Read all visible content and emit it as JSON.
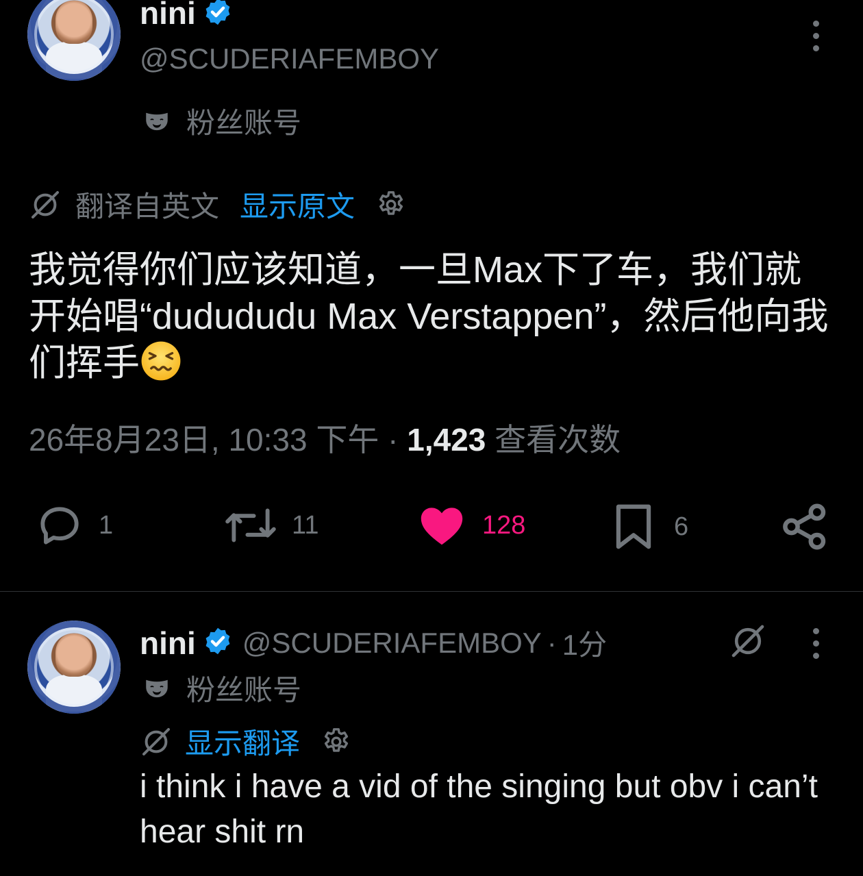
{
  "main_tweet": {
    "author": {
      "display_name": "nini",
      "handle": "@SCUDERIAFEMBOY",
      "label": "粉丝账号"
    },
    "translation": {
      "note": "翻译自英文",
      "show_original": "显示原文"
    },
    "text": "我觉得你们应该知道，一旦Max下了车，我们就开始唱“dudududu Max Verstappen”，然后他向我们挥手",
    "timestamp": "26年8月23日, 10:33 下午",
    "separator": "·",
    "views_count": "1,423",
    "views_label": "查看次数",
    "actions": {
      "replies": "1",
      "retweets": "11",
      "likes": "128",
      "bookmarks": "6"
    }
  },
  "reply_tweet": {
    "author": {
      "display_name": "nini",
      "handle": "@SCUDERIAFEMBOY",
      "separator": "·",
      "time": "1分",
      "label": "粉丝账号"
    },
    "translation": {
      "show_translation": "显示翻译"
    },
    "text": "i think i have a vid of the singing but obv i can’t hear shit rn"
  },
  "icons": {
    "verified": "verified-badge-icon",
    "fan_account": "mask-icon",
    "translate": "translate-slash-icon",
    "settings": "gear-icon",
    "more": "more-vertical-icon",
    "reply": "comment-icon",
    "retweet": "retweet-icon",
    "like": "heart-icon",
    "bookmark": "bookmark-icon",
    "share": "share-icon",
    "emoji": "confounded-face-emoji"
  },
  "colors": {
    "background": "#000000",
    "text_primary": "#e7e9ea",
    "text_secondary": "#71767b",
    "link": "#1d9bf0",
    "like": "#f91880",
    "verified": "#1d9bf0"
  }
}
